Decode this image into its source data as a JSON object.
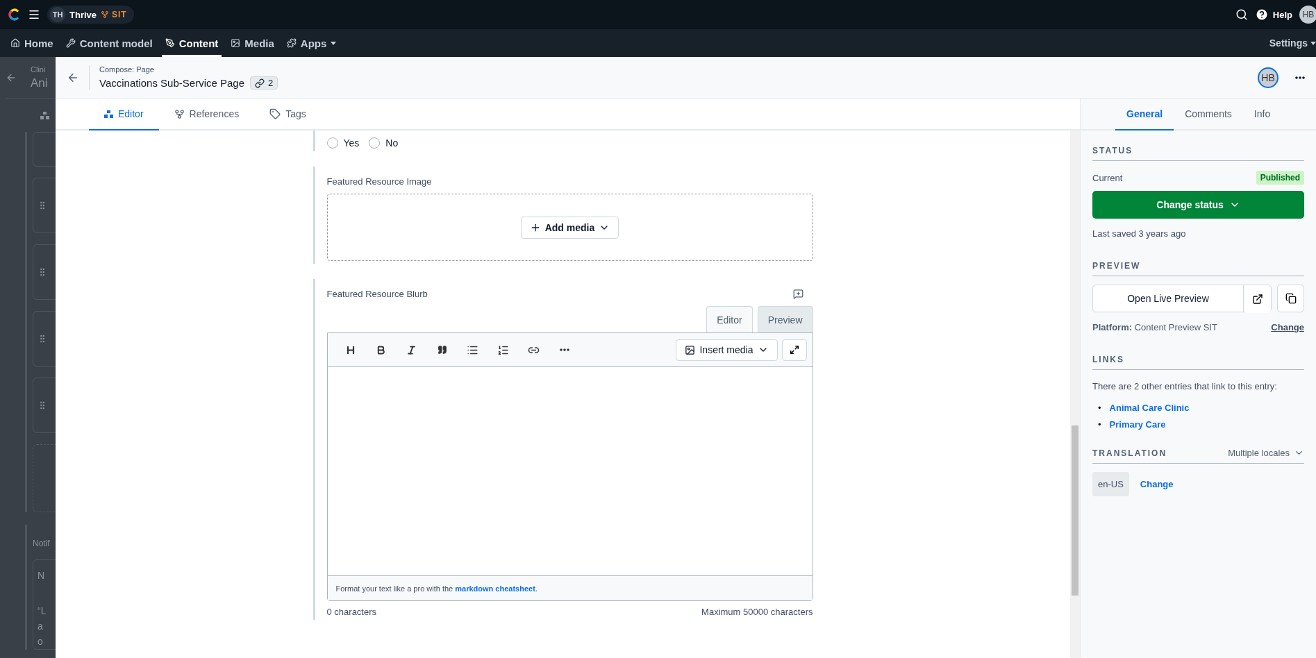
{
  "top_bar": {
    "space_initials": "TH",
    "space_name": "Thrive",
    "environment": "SIT",
    "help": "Help",
    "user_initials": "HB"
  },
  "nav": [
    {
      "label": "Home",
      "selected": false
    },
    {
      "label": "Content model",
      "selected": false
    },
    {
      "label": "Content",
      "selected": true
    },
    {
      "label": "Media",
      "selected": false
    },
    {
      "label": "Apps",
      "selected": false,
      "dropdown": true
    }
  ],
  "settings": "Settings",
  "background_page": {
    "breadcrumb": "Clini",
    "title": "Ani",
    "section_label": "Notif",
    "table_header": "N",
    "text_lines": [
      "“L",
      "a",
      "o"
    ]
  },
  "entry": {
    "breadcrumb": "Compose: Page",
    "title": "Vaccinations Sub-Service Page",
    "references_count": "2",
    "user_initials": "HB"
  },
  "tabs": [
    {
      "label": "Editor",
      "selected": true
    },
    {
      "label": "References",
      "selected": false
    },
    {
      "label": "Tags",
      "selected": false
    }
  ],
  "fields": [
    {
      "kind": "radio",
      "options": [
        {
          "label": "Yes",
          "selected": false
        },
        {
          "label": "No",
          "selected": false
        }
      ]
    },
    {
      "kind": "media",
      "label": "Featured Resource Image",
      "button": "Add media"
    },
    {
      "kind": "markdown",
      "label": "Featured Resource Blurb",
      "modes": [
        {
          "label": "Editor",
          "selected": true
        },
        {
          "label": "Preview",
          "selected": false
        }
      ],
      "insert_media": "Insert media",
      "hint": "Format your text like a pro with the ",
      "hint_link": "markdown cheatsheet",
      "hint_end": ".",
      "character_count": "0 characters",
      "max_characters": "Maximum 50000 characters"
    }
  ],
  "sidebar": {
    "tabs": [
      {
        "label": "General",
        "selected": true
      },
      {
        "label": "Comments",
        "selected": false
      },
      {
        "label": "Info",
        "selected": false
      }
    ],
    "status": {
      "heading": "STATUS",
      "current_label": "Current",
      "badge": "Published",
      "button": "Change status",
      "last_saved": "Last saved 3 years ago"
    },
    "preview": {
      "heading": "PREVIEW",
      "button": "Open Live Preview",
      "platform_label": "Platform:",
      "platform": "Content Preview SIT",
      "change": "Change"
    },
    "links": {
      "heading": "LINKS",
      "text": "There are 2 other entries that link to this entry:",
      "items": [
        {
          "bullet": "•",
          "label": "Animal Care Clinic"
        },
        {
          "bullet": "•",
          "label": "Primary Care"
        }
      ]
    },
    "translation": {
      "heading": "TRANSLATION",
      "locales": "Multiple locales",
      "locale": "en-US",
      "change": "Change"
    }
  }
}
